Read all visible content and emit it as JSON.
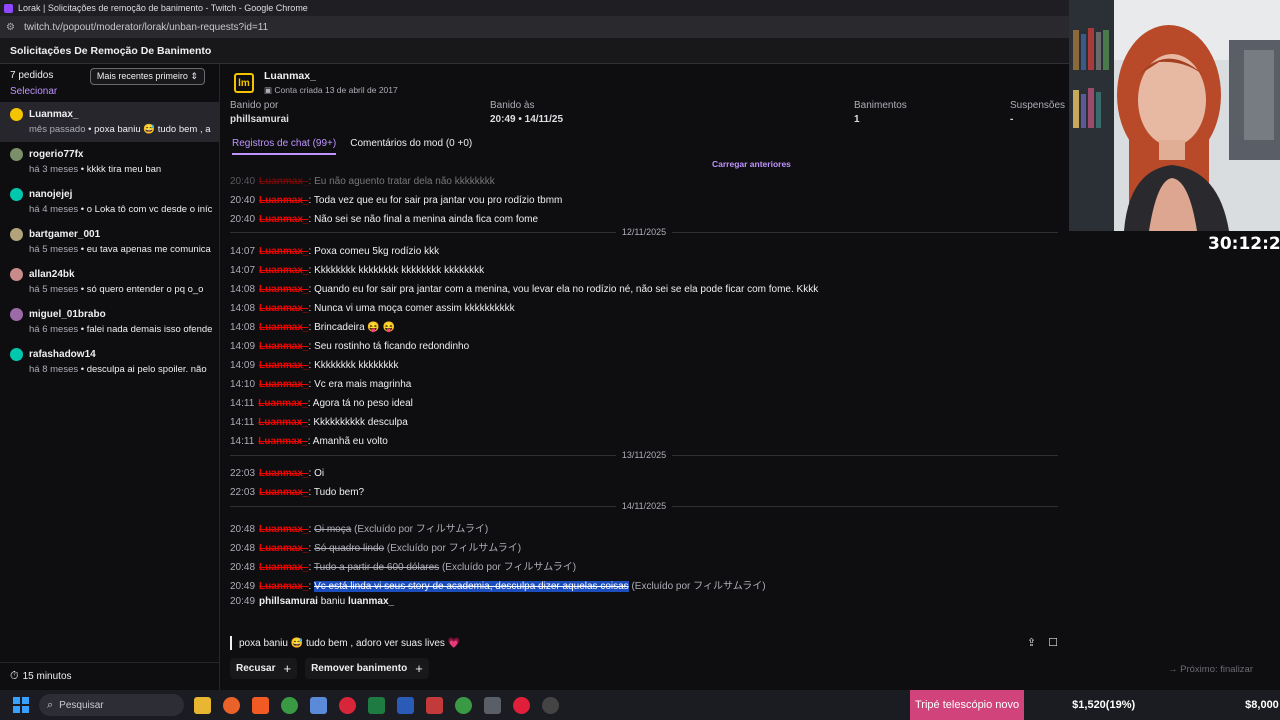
{
  "window": {
    "title": "Lorak | Solicitações de remoção de banimento - Twitch - Google Chrome",
    "url": "twitch.tv/popout/moderator/lorak/unban-requests?id=11"
  },
  "page_title": "Solicitações De Remoção De Banimento",
  "left": {
    "count": "7 pedidos",
    "select": "Selecionar",
    "sort": "Mais recentes primeiro",
    "requests": [
      {
        "name": "Luanmax_",
        "ago": "mês passado",
        "text": "poxa baniu 😅 tudo bem , a",
        "color": "#f5c400"
      },
      {
        "name": "rogerio77fx",
        "ago": "há 3 meses",
        "text": "kkkk tira meu ban",
        "color": "#7a8f6a"
      },
      {
        "name": "nanojejej",
        "ago": "há 4 meses",
        "text": "o Loka tô com vc desde o iníc",
        "color": "#00c8af"
      },
      {
        "name": "bartgamer_001",
        "ago": "há 5 meses",
        "text": "eu tava apenas me comunica",
        "color": "#b2a37a"
      },
      {
        "name": "allan24bk",
        "ago": "há 5 meses",
        "text": "só quero entender o pq o_o",
        "color": "#c98a8a"
      },
      {
        "name": "miguel_01brabo",
        "ago": "há 6 meses",
        "text": "falei nada demais isso ofende",
        "color": "#9d6aa8"
      },
      {
        "name": "rafashadow14",
        "ago": "há 8 meses",
        "text": "desculpa ai pelo spoiler. não",
        "color": "#00c8af"
      }
    ],
    "timer": "15 minutos"
  },
  "user": {
    "name": "Luanmax_",
    "created": "Conta criada 13 de abril de 2017",
    "logo": "lm"
  },
  "stats": {
    "banned_by_label": "Banido por",
    "banned_by": "phillsamurai",
    "banned_at_label": "Banido às",
    "banned_at": "20:49 • 14/11/25",
    "bans_label": "Banimentos",
    "bans": "1",
    "suspensions_label": "Suspensões",
    "suspensions": "-"
  },
  "tabs": {
    "chat": "Registros de chat (99+)",
    "mod": "Comentários do mod (0 +0)"
  },
  "load_previous": "Carregar anteriores",
  "chat": {
    "user": "Luanmax_",
    "msgs": [
      {
        "time": "20:40",
        "text": "Eu não aguento tratar dela não kkkkkkkk"
      },
      {
        "time": "20:40",
        "text": "Toda vez que eu for sair pra jantar vou pro rodízio tbmm"
      },
      {
        "time": "20:40",
        "text": "Não sei se não final a menina ainda fica com fome"
      },
      {
        "time": "14:07",
        "text": "Poxa comeu 5kg rodízio kkk"
      },
      {
        "time": "14:07",
        "text": "Kkkkkkkk kkkkkkkk kkkkkkkk kkkkkkkk"
      },
      {
        "time": "14:08",
        "text": "Quando eu for sair pra jantar com a menina, vou levar ela no rodízio né, não sei se ela pode ficar com fome. Kkkk"
      },
      {
        "time": "14:08",
        "text": "Nunca vi uma moça comer assim kkkkkkkkkk"
      },
      {
        "time": "14:08",
        "text": "Brincadeira 😝 😝"
      },
      {
        "time": "14:09",
        "text": "Seu rostinho tá ficando redondinho"
      },
      {
        "time": "14:09",
        "text": "Kkkkkkkk kkkkkkkk"
      },
      {
        "time": "14:10",
        "text": "Vc era mais magrinha"
      },
      {
        "time": "14:11",
        "text": "Agora tá no peso ideal"
      },
      {
        "time": "14:11",
        "text": "Kkkkkkkkkk desculpa"
      },
      {
        "time": "14:11",
        "text": "Amanhã eu volto"
      },
      {
        "time": "22:03",
        "text": "Oi"
      },
      {
        "time": "22:03",
        "text": "Tudo bem?"
      },
      {
        "time": "20:48",
        "text": "Oi moça",
        "note": "(Excluído por フィルサムライ)"
      },
      {
        "time": "20:48",
        "text": "Só quadro lindo",
        "note": "(Excluído por フィルサムライ)"
      },
      {
        "time": "20:48",
        "text": "Tudo a partir de 600 dólares",
        "note": "(Excluído por フィルサムライ)"
      },
      {
        "time": "20:49",
        "text": "Vc está linda vi seus story de academia, desculpa dizer aquelas coisas",
        "note": "(Excluído por フィルサムライ)"
      }
    ],
    "dates": [
      "12/11/2025",
      "13/11/2025",
      "14/11/2025"
    ],
    "ban": {
      "time": "20:49",
      "mod": "phillsamurai",
      "verb": "baniu",
      "target": "luanmax_"
    }
  },
  "appeal_text": "poxa baniu 😅 tudo bem , adoro ver suas lives 💗",
  "actions": {
    "deny": "Recusar",
    "unban": "Remover banimento",
    "next": "Próximo: finalizar"
  },
  "clock": "30:12:26",
  "taskbar": {
    "search": "Pesquisar",
    "ticker_label": "Tripé telescópio novo",
    "ticker_progress": "$1,520(19%)",
    "ticker_goal": "$8,000"
  }
}
